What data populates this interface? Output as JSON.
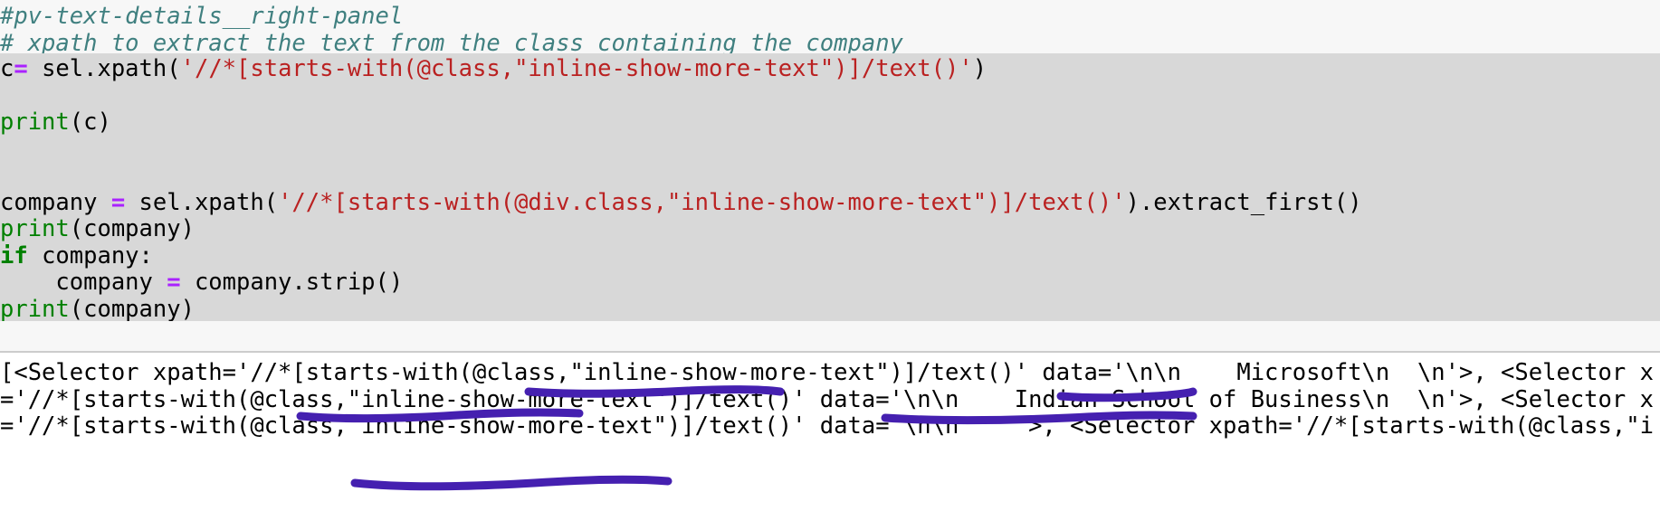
{
  "cell": {
    "comments": [
      "#pv-text-details__right-panel",
      "# xpath to extract the text from the class containing the company"
    ],
    "code_lines": [
      {
        "id": "line-c-assign",
        "segments": [
          {
            "cls": "pln",
            "text": "c"
          },
          {
            "cls": "op",
            "text": "="
          },
          {
            "cls": "pln",
            "text": " sel.xpath("
          },
          {
            "cls": "str",
            "text": "'//*[starts-with(@class,\"inline-show-more-text\")]/text()'"
          },
          {
            "cls": "pln",
            "text": ")"
          }
        ]
      },
      {
        "id": "line-blank-1",
        "segments": [
          {
            "cls": "pln",
            "text": ""
          }
        ]
      },
      {
        "id": "line-print-c",
        "segments": [
          {
            "cls": "fn",
            "text": "print"
          },
          {
            "cls": "pln",
            "text": "(c)"
          }
        ]
      },
      {
        "id": "line-blank-2",
        "segments": [
          {
            "cls": "pln",
            "text": ""
          }
        ]
      },
      {
        "id": "line-blank-3",
        "segments": [
          {
            "cls": "pln",
            "text": ""
          }
        ]
      },
      {
        "id": "line-company-assign",
        "segments": [
          {
            "cls": "pln",
            "text": "company "
          },
          {
            "cls": "op",
            "text": "="
          },
          {
            "cls": "pln",
            "text": " sel.xpath("
          },
          {
            "cls": "str",
            "text": "'//*[starts-with(@div.class,\"inline-show-more-text\")]/text()'"
          },
          {
            "cls": "pln",
            "text": ").extract_first()"
          }
        ]
      },
      {
        "id": "line-print-company-1",
        "segments": [
          {
            "cls": "fn",
            "text": "print"
          },
          {
            "cls": "pln",
            "text": "(company)"
          }
        ]
      },
      {
        "id": "line-if-company",
        "segments": [
          {
            "cls": "kw",
            "text": "if"
          },
          {
            "cls": "pln",
            "text": " company:"
          }
        ]
      },
      {
        "id": "line-company-strip",
        "segments": [
          {
            "cls": "pln",
            "text": "    company "
          },
          {
            "cls": "op",
            "text": "="
          },
          {
            "cls": "pln",
            "text": " company.strip()"
          }
        ]
      },
      {
        "id": "line-print-company-2",
        "segments": [
          {
            "cls": "fn",
            "text": "print"
          },
          {
            "cls": "pln",
            "text": "(company)"
          }
        ]
      }
    ]
  },
  "output": {
    "lines": [
      "[<Selector xpath='//*[starts-with(@class,\"inline-show-more-text\")]/text()' data='\\n\\n    Microsoft\\n  \\n'>, <Selector x",
      "='//*[starts-with(@class,\"inline-show-more-text\")]/text()' data='\\n\\n    Indian School of Business\\n  \\n'>, <Selector x",
      "='//*[starts-with(@class,\"inline-show-more-text\")]/text()' data='\\n\\n    '>, <Selector xpath='//*[starts-with(@class,\"i",
      "                                                                                                                     "
    ]
  },
  "annotations": {
    "ink_color": "#4520b0",
    "marks": [
      {
        "name": "underline-inline-show-more-text-line1",
        "label": "inline-show-more-text"
      },
      {
        "name": "underline-microsoft",
        "label": "Microsoft"
      },
      {
        "name": "underline-inline-show-more-text-line2",
        "label": "inline-show-more-text"
      },
      {
        "name": "underline-indian-school-of-business",
        "label": "Indian School of Business"
      },
      {
        "name": "underline-inline-show-more-text-line3",
        "label": "inline-show-more-text"
      }
    ]
  },
  "colors": {
    "selection_bg": "#d8d8d8",
    "cell_bg": "#f7f7f7",
    "output_bg": "#ffffff",
    "comment": "#408080",
    "string": "#ba2121",
    "keyword": "#008000",
    "operator": "#aa22ff",
    "plain": "#000000",
    "divider": "#cccccc"
  }
}
